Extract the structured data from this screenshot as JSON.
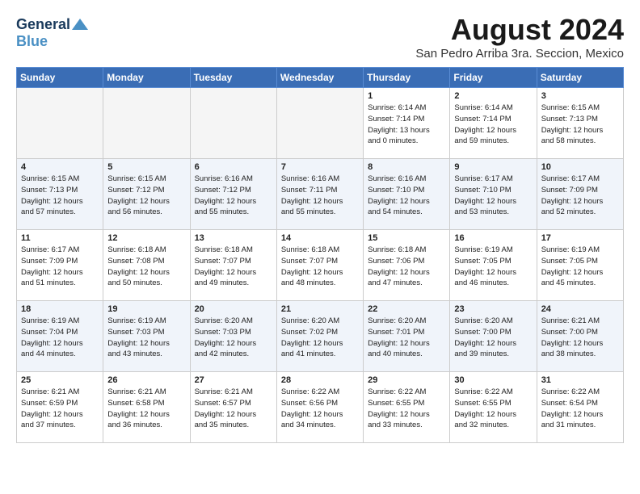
{
  "logo": {
    "general": "General",
    "blue": "Blue"
  },
  "title": "August 2024",
  "location": "San Pedro Arriba 3ra. Seccion, Mexico",
  "days_header": [
    "Sunday",
    "Monday",
    "Tuesday",
    "Wednesday",
    "Thursday",
    "Friday",
    "Saturday"
  ],
  "weeks": [
    [
      {
        "num": "",
        "info": ""
      },
      {
        "num": "",
        "info": ""
      },
      {
        "num": "",
        "info": ""
      },
      {
        "num": "",
        "info": ""
      },
      {
        "num": "1",
        "info": "Sunrise: 6:14 AM\nSunset: 7:14 PM\nDaylight: 13 hours\nand 0 minutes."
      },
      {
        "num": "2",
        "info": "Sunrise: 6:14 AM\nSunset: 7:14 PM\nDaylight: 12 hours\nand 59 minutes."
      },
      {
        "num": "3",
        "info": "Sunrise: 6:15 AM\nSunset: 7:13 PM\nDaylight: 12 hours\nand 58 minutes."
      }
    ],
    [
      {
        "num": "4",
        "info": "Sunrise: 6:15 AM\nSunset: 7:13 PM\nDaylight: 12 hours\nand 57 minutes."
      },
      {
        "num": "5",
        "info": "Sunrise: 6:15 AM\nSunset: 7:12 PM\nDaylight: 12 hours\nand 56 minutes."
      },
      {
        "num": "6",
        "info": "Sunrise: 6:16 AM\nSunset: 7:12 PM\nDaylight: 12 hours\nand 55 minutes."
      },
      {
        "num": "7",
        "info": "Sunrise: 6:16 AM\nSunset: 7:11 PM\nDaylight: 12 hours\nand 55 minutes."
      },
      {
        "num": "8",
        "info": "Sunrise: 6:16 AM\nSunset: 7:10 PM\nDaylight: 12 hours\nand 54 minutes."
      },
      {
        "num": "9",
        "info": "Sunrise: 6:17 AM\nSunset: 7:10 PM\nDaylight: 12 hours\nand 53 minutes."
      },
      {
        "num": "10",
        "info": "Sunrise: 6:17 AM\nSunset: 7:09 PM\nDaylight: 12 hours\nand 52 minutes."
      }
    ],
    [
      {
        "num": "11",
        "info": "Sunrise: 6:17 AM\nSunset: 7:09 PM\nDaylight: 12 hours\nand 51 minutes."
      },
      {
        "num": "12",
        "info": "Sunrise: 6:18 AM\nSunset: 7:08 PM\nDaylight: 12 hours\nand 50 minutes."
      },
      {
        "num": "13",
        "info": "Sunrise: 6:18 AM\nSunset: 7:07 PM\nDaylight: 12 hours\nand 49 minutes."
      },
      {
        "num": "14",
        "info": "Sunrise: 6:18 AM\nSunset: 7:07 PM\nDaylight: 12 hours\nand 48 minutes."
      },
      {
        "num": "15",
        "info": "Sunrise: 6:18 AM\nSunset: 7:06 PM\nDaylight: 12 hours\nand 47 minutes."
      },
      {
        "num": "16",
        "info": "Sunrise: 6:19 AM\nSunset: 7:05 PM\nDaylight: 12 hours\nand 46 minutes."
      },
      {
        "num": "17",
        "info": "Sunrise: 6:19 AM\nSunset: 7:05 PM\nDaylight: 12 hours\nand 45 minutes."
      }
    ],
    [
      {
        "num": "18",
        "info": "Sunrise: 6:19 AM\nSunset: 7:04 PM\nDaylight: 12 hours\nand 44 minutes."
      },
      {
        "num": "19",
        "info": "Sunrise: 6:19 AM\nSunset: 7:03 PM\nDaylight: 12 hours\nand 43 minutes."
      },
      {
        "num": "20",
        "info": "Sunrise: 6:20 AM\nSunset: 7:03 PM\nDaylight: 12 hours\nand 42 minutes."
      },
      {
        "num": "21",
        "info": "Sunrise: 6:20 AM\nSunset: 7:02 PM\nDaylight: 12 hours\nand 41 minutes."
      },
      {
        "num": "22",
        "info": "Sunrise: 6:20 AM\nSunset: 7:01 PM\nDaylight: 12 hours\nand 40 minutes."
      },
      {
        "num": "23",
        "info": "Sunrise: 6:20 AM\nSunset: 7:00 PM\nDaylight: 12 hours\nand 39 minutes."
      },
      {
        "num": "24",
        "info": "Sunrise: 6:21 AM\nSunset: 7:00 PM\nDaylight: 12 hours\nand 38 minutes."
      }
    ],
    [
      {
        "num": "25",
        "info": "Sunrise: 6:21 AM\nSunset: 6:59 PM\nDaylight: 12 hours\nand 37 minutes."
      },
      {
        "num": "26",
        "info": "Sunrise: 6:21 AM\nSunset: 6:58 PM\nDaylight: 12 hours\nand 36 minutes."
      },
      {
        "num": "27",
        "info": "Sunrise: 6:21 AM\nSunset: 6:57 PM\nDaylight: 12 hours\nand 35 minutes."
      },
      {
        "num": "28",
        "info": "Sunrise: 6:22 AM\nSunset: 6:56 PM\nDaylight: 12 hours\nand 34 minutes."
      },
      {
        "num": "29",
        "info": "Sunrise: 6:22 AM\nSunset: 6:55 PM\nDaylight: 12 hours\nand 33 minutes."
      },
      {
        "num": "30",
        "info": "Sunrise: 6:22 AM\nSunset: 6:55 PM\nDaylight: 12 hours\nand 32 minutes."
      },
      {
        "num": "31",
        "info": "Sunrise: 6:22 AM\nSunset: 6:54 PM\nDaylight: 12 hours\nand 31 minutes."
      }
    ]
  ]
}
